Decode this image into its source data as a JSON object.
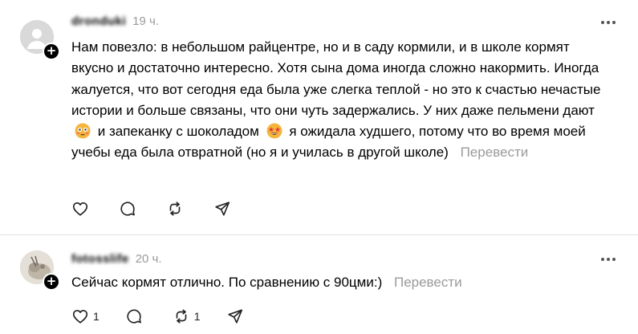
{
  "comments": [
    {
      "username": "dronduki",
      "time": "19 ч.",
      "avatar_icon": "default-avatar-icon",
      "text_parts": {
        "p1": "Нам повезло: в небольшом райцентре, но и в саду кормили, и в школе кормят вкусно и достаточно интересно. Хотя сына дома иногда сложно накормить. Иногда жалуется, что вот сегодня еда была уже слегка теплой - но это к счастью нечастые истории и больше связаны, что они чуть задержались. У них даже пельмени дают",
        "p2": "и запеканку с шоколадом",
        "p3": "я ожидала худшего, потому что во время моей учебы еда была отвратной (но я и училась в другой школе)"
      },
      "emojis": [
        "flushed-face-icon",
        "star-struck-face-icon"
      ],
      "translate_label": "Перевести",
      "likes": "",
      "replies": "",
      "reposts": ""
    },
    {
      "username": "fotosslife",
      "time": "20 ч.",
      "avatar_icon": "photo-avatar-icon",
      "text": "Сейчас кормят отлично. По сравнению с 90цми:)",
      "translate_label": "Перевести",
      "likes": "1",
      "replies": "",
      "reposts": "1"
    }
  ],
  "colors": {
    "secondary_text": "#9a9a9a",
    "divider": "#e2e2e2",
    "icon": "#222222"
  }
}
